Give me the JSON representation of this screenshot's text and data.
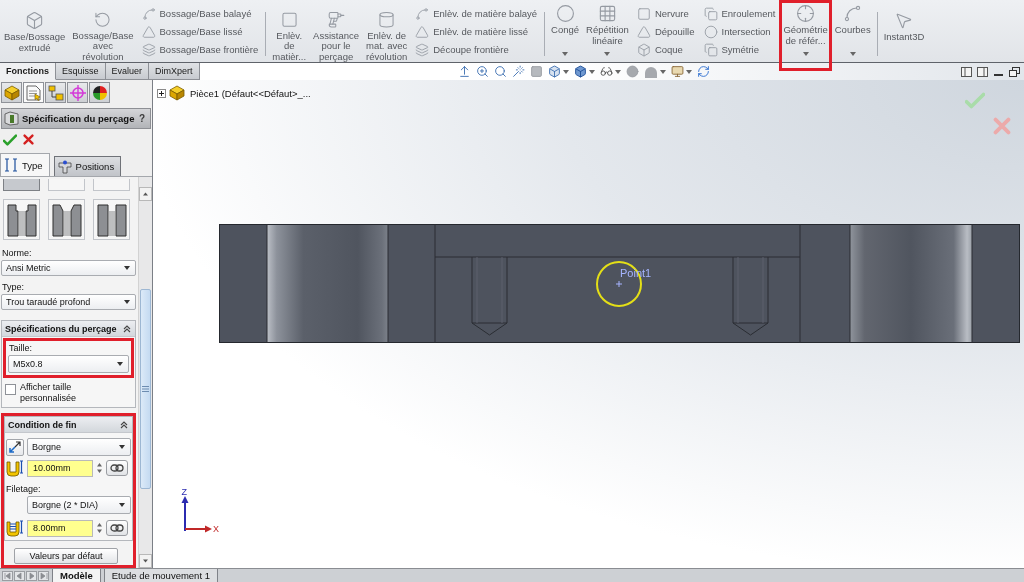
{
  "ribbon": {
    "disabled": true,
    "groups": [
      {
        "items": [
          {
            "kind": "large",
            "label": "Base/Bossage\nextrudé",
            "dropdown": false,
            "highlighted": false
          },
          {
            "kind": "large",
            "label": "Bossage/Base\navec\nrévolution",
            "dropdown": false,
            "highlighted": false
          },
          {
            "kind": "stack",
            "items": [
              {
                "label": "Bossage/Base balayé"
              },
              {
                "label": "Bossage/Base lissé"
              },
              {
                "label": "Bossage/Base frontière"
              }
            ]
          }
        ]
      },
      {
        "items": [
          {
            "kind": "large",
            "label": "Enlèv.\nde\nmatièr...",
            "dropdown": false,
            "highlighted": false
          },
          {
            "kind": "large",
            "label": "Assistance\npour le\nperçage",
            "dropdown": false,
            "highlighted": false
          },
          {
            "kind": "large",
            "label": "Enlèv. de\nmat. avec\nrévolution",
            "dropdown": false,
            "highlighted": false
          },
          {
            "kind": "stack",
            "items": [
              {
                "label": "Enlèv. de matière balayé"
              },
              {
                "label": "Enlèv. de matière lissé"
              },
              {
                "label": "Découpe frontière"
              }
            ]
          }
        ]
      },
      {
        "items": [
          {
            "kind": "large",
            "label": "Congé",
            "dropdown": true,
            "highlighted": false
          },
          {
            "kind": "large",
            "label": "Répétition\nlinéaire",
            "dropdown": true,
            "highlighted": false
          },
          {
            "kind": "stack",
            "items": [
              {
                "label": "Nervure"
              },
              {
                "label": "Dépouille"
              },
              {
                "label": "Coque"
              }
            ]
          },
          {
            "kind": "stack",
            "items": [
              {
                "label": "Enroulement"
              },
              {
                "label": "Intersection"
              },
              {
                "label": "Symétrie"
              }
            ]
          },
          {
            "kind": "large",
            "label": "Géométrie\nde référ...",
            "dropdown": true,
            "highlighted": true
          },
          {
            "kind": "large",
            "label": "Courbes",
            "dropdown": true,
            "highlighted": false
          }
        ]
      },
      {
        "items": [
          {
            "kind": "large",
            "label": "Instant3D",
            "dropdown": false,
            "highlighted": false
          }
        ]
      }
    ]
  },
  "command_tabs": [
    {
      "label": "Fonctions",
      "selected": true
    },
    {
      "label": "Esquisse",
      "selected": false
    },
    {
      "label": "Evaluer",
      "selected": false
    },
    {
      "label": "DimXpert",
      "selected": false
    }
  ],
  "view_toolbar": [
    {
      "dropdown": false
    },
    {
      "dropdown": false
    },
    {
      "dropdown": false
    },
    {
      "dropdown": false
    },
    {
      "dropdown": false
    },
    {
      "dropdown": true
    },
    {
      "dropdown": true
    },
    {
      "dropdown": true
    },
    {
      "dropdown": false
    },
    {
      "dropdown": true
    },
    {
      "dropdown": true
    },
    {
      "dropdown": false
    }
  ],
  "feature_tree": {
    "expanded": false,
    "label": "Pièce1 (Défaut<<Défaut>_..."
  },
  "property_manager": {
    "panel_tabs": [
      {
        "selected": false
      },
      {
        "selected": true
      },
      {
        "selected": false
      },
      {
        "selected": false
      },
      {
        "selected": false
      }
    ],
    "title": "Spécification du perçage",
    "help": "?",
    "type_tabs": [
      {
        "label": "Type",
        "selected": true
      },
      {
        "label": "Positions",
        "selected": false
      }
    ],
    "hole_type_rows": [
      [
        {
          "selected": true
        },
        {
          "selected": false
        },
        {
          "selected": false
        }
      ],
      [
        {
          "kind": "stepped",
          "selected": false
        },
        {
          "kind": "tapered",
          "selected": false
        },
        {
          "kind": "straight",
          "selected": false
        }
      ]
    ],
    "standard": {
      "label": "Norme:",
      "value": "Ansi Metric"
    },
    "type": {
      "label": "Type:",
      "value": "Trou taraudé profond"
    },
    "sections": [
      {
        "kind": "spec",
        "title": "Spécifications du perçage",
        "expanded": true,
        "size_label": "Taille:",
        "size": "M5x0.8",
        "size_highlighted": true,
        "custom_size": {
          "label": "Afficher taille\npersonnalisée",
          "checked": false
        }
      },
      {
        "kind": "end",
        "title": "Condition de fin",
        "expanded": true,
        "highlighted": true,
        "end_condition": "Borgne",
        "depth": "10.00mm",
        "thread_label": "Filetage:",
        "thread_condition": "Borgne (2 * DIA)",
        "thread_depth": "8.00mm",
        "defaults_button": "Valeurs par défaut"
      }
    ]
  },
  "viewport": {
    "point_label": "Point1",
    "axis_triad": {
      "z_label": "Z",
      "x_label": "X"
    }
  },
  "bottom_tabs": [
    {
      "label": "Modèle",
      "selected": true
    },
    {
      "label": "Etude de mouvement 1",
      "selected": false
    }
  ]
}
